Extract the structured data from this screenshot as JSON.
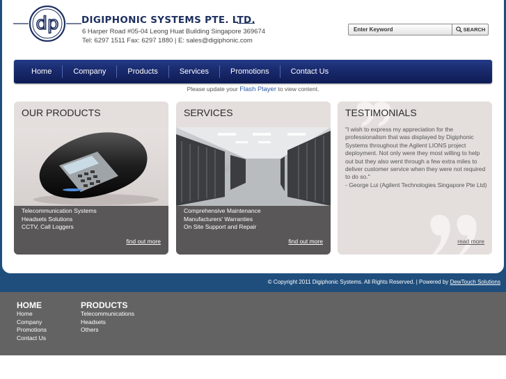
{
  "company": {
    "name": "DIGIPHONIC SYSTEMS PTE. LTD.",
    "address": "6 Harper Road #05-04 Leong Huat Building  Singapore 369674",
    "contact": "Tel: 6297 1511 Fax: 6297 1880  |  E: sales@digiphonic.com",
    "logo_text": "dp"
  },
  "search": {
    "placeholder": "Enter Keyword",
    "button_label": "SEARCH"
  },
  "nav": {
    "items": [
      {
        "label": "Home"
      },
      {
        "label": "Company"
      },
      {
        "label": "Products"
      },
      {
        "label": "Services"
      },
      {
        "label": "Promotions"
      },
      {
        "label": "Contact Us"
      }
    ]
  },
  "flash_note": {
    "before": "Please update your",
    "link": "Flash Player",
    "after": "to view content."
  },
  "products_panel": {
    "title": "OUR PRODUCTS",
    "items": [
      "Telecommunication Systems",
      "Headsets Solutions",
      "CCTV, Call Loggers"
    ],
    "link": "find out more"
  },
  "services_panel": {
    "title": "SERVICES",
    "items": [
      "Comprehensive Maintenance",
      "Manufacturers' Warranties",
      "On Site Support and Repair"
    ],
    "link": "find out more"
  },
  "testimonials_panel": {
    "title": "TESTIMONIALS",
    "quote": "\"I wish to express my appreciation for the professionalism that was displayed by Digiphonic Systems throughout the Agilent LIONS project deployment. Not only were they most willing to help out but they also went through a few extra miles to deliver customer service when they were not required to do so.\"",
    "author": "- George Lui (Agilent Technologies Singapore Pte Ltd)",
    "link": "read more"
  },
  "copyright": {
    "text": "© Copyright 2011 Digiphonic Systems. All Rights Reserved. | Powered by",
    "link": "DewTouch Solutions"
  },
  "footer": {
    "home": {
      "heading": "HOME",
      "items": [
        "Home",
        "Company",
        "Promotions",
        "Contact Us"
      ]
    },
    "products": {
      "heading": "PRODUCTS",
      "items": [
        "Telecommunications",
        "Headsets",
        "Others"
      ]
    }
  },
  "colors": {
    "nav_dark": "#18286a",
    "frame_blue": "#1f4e7d",
    "panel_bg": "#e4dedd",
    "panel_dark": "#595758",
    "footer_bg": "#636363"
  }
}
